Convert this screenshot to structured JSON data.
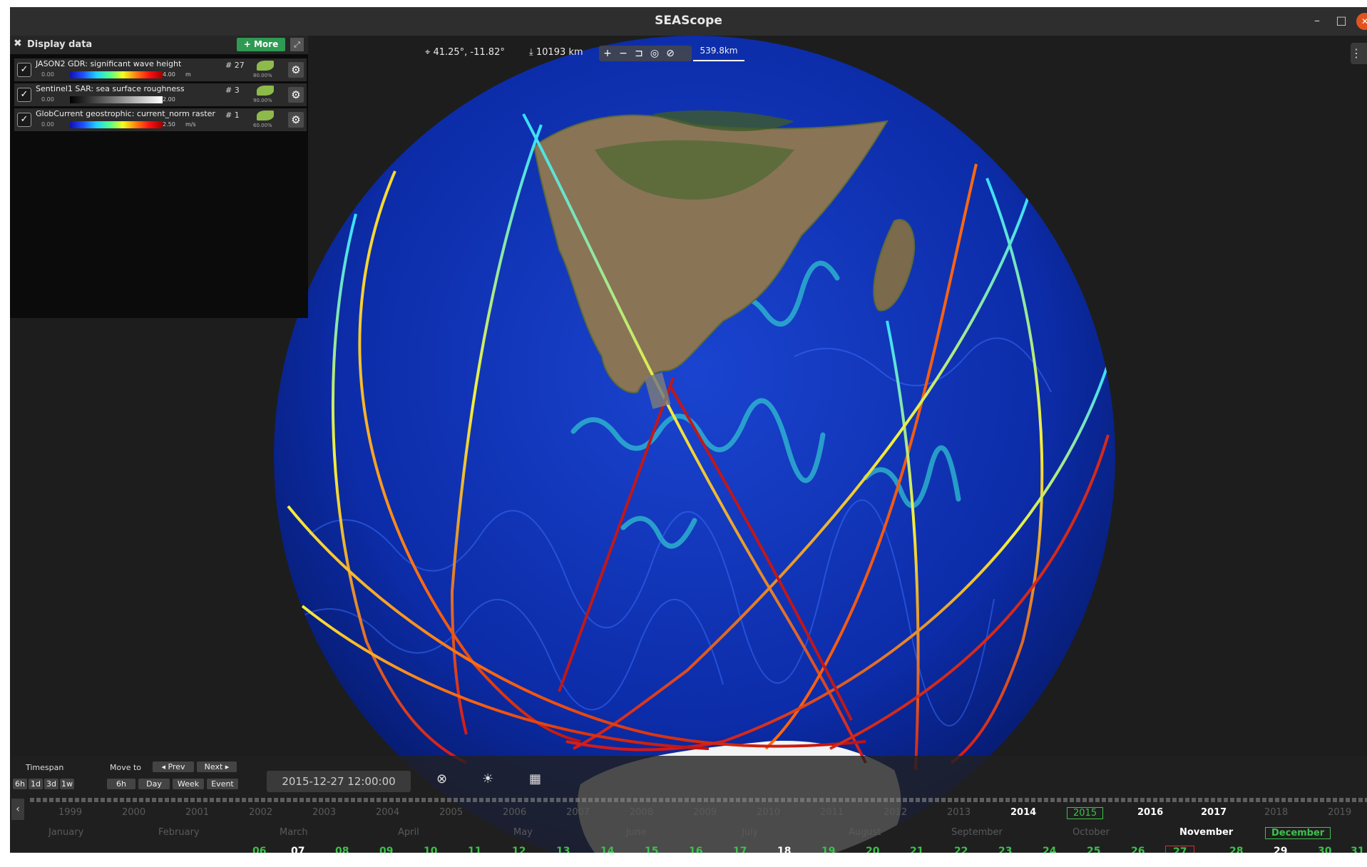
{
  "window": {
    "title": "SEAScope"
  },
  "panel": {
    "title": "Display data",
    "more_label": "+ More",
    "layers": [
      {
        "name": "JASON2 GDR: significant wave height",
        "min": "0.00",
        "max": "4.00",
        "unit": "m",
        "count": "# 27",
        "opacity": "80.00%",
        "colorbar": "jet"
      },
      {
        "name": "Sentinel1 SAR: sea surface roughness",
        "min": "0.00",
        "max": "2.00",
        "unit": "",
        "count": "# 3",
        "opacity": "90.00%",
        "colorbar": "gray"
      },
      {
        "name": "GlobCurrent geostrophic: current_norm raster",
        "min": "0.00",
        "max": "2.50",
        "unit": "m/s",
        "count": "# 1",
        "opacity": "60.00%",
        "colorbar": "jet"
      }
    ]
  },
  "toolbar": {
    "coordinates": "41.25°, -11.82°",
    "altitude": "10193 km",
    "scale": "539.8km"
  },
  "bottom": {
    "timespan_label": "Timespan",
    "timespan_buttons": [
      "6h",
      "1d",
      "3d",
      "1w"
    ],
    "move_label": "Move to",
    "prev_label": "◂ Prev",
    "next_label": "Next ▸",
    "move_buttons": [
      "6h",
      "Day",
      "Week",
      "Event"
    ],
    "datetime": "2015-12-27 12:00:00",
    "years": [
      "1999",
      "2000",
      "2001",
      "2002",
      "2003",
      "2004",
      "2005",
      "2006",
      "2007",
      "2008",
      "2009",
      "2010",
      "2011",
      "2012",
      "2013",
      "2014",
      "2015",
      "2016",
      "2017",
      "2018",
      "2019"
    ],
    "months": [
      "January",
      "February",
      "March",
      "April",
      "May",
      "June",
      "July",
      "August",
      "September",
      "October",
      "November",
      "December"
    ],
    "days": [
      "06",
      "07",
      "08",
      "09",
      "10",
      "11",
      "12",
      "13",
      "14",
      "15",
      "16",
      "17",
      "18",
      "19",
      "20",
      "21",
      "22",
      "23",
      "24",
      "25",
      "26",
      "27",
      "28",
      "29",
      "30",
      "31"
    ],
    "selected_year": "2015",
    "selected_month": "December",
    "selected_day": "27"
  },
  "colors": {
    "accent_green": "#3cc24a",
    "selection_red": "#d43030",
    "close_orange": "#e2541f"
  }
}
